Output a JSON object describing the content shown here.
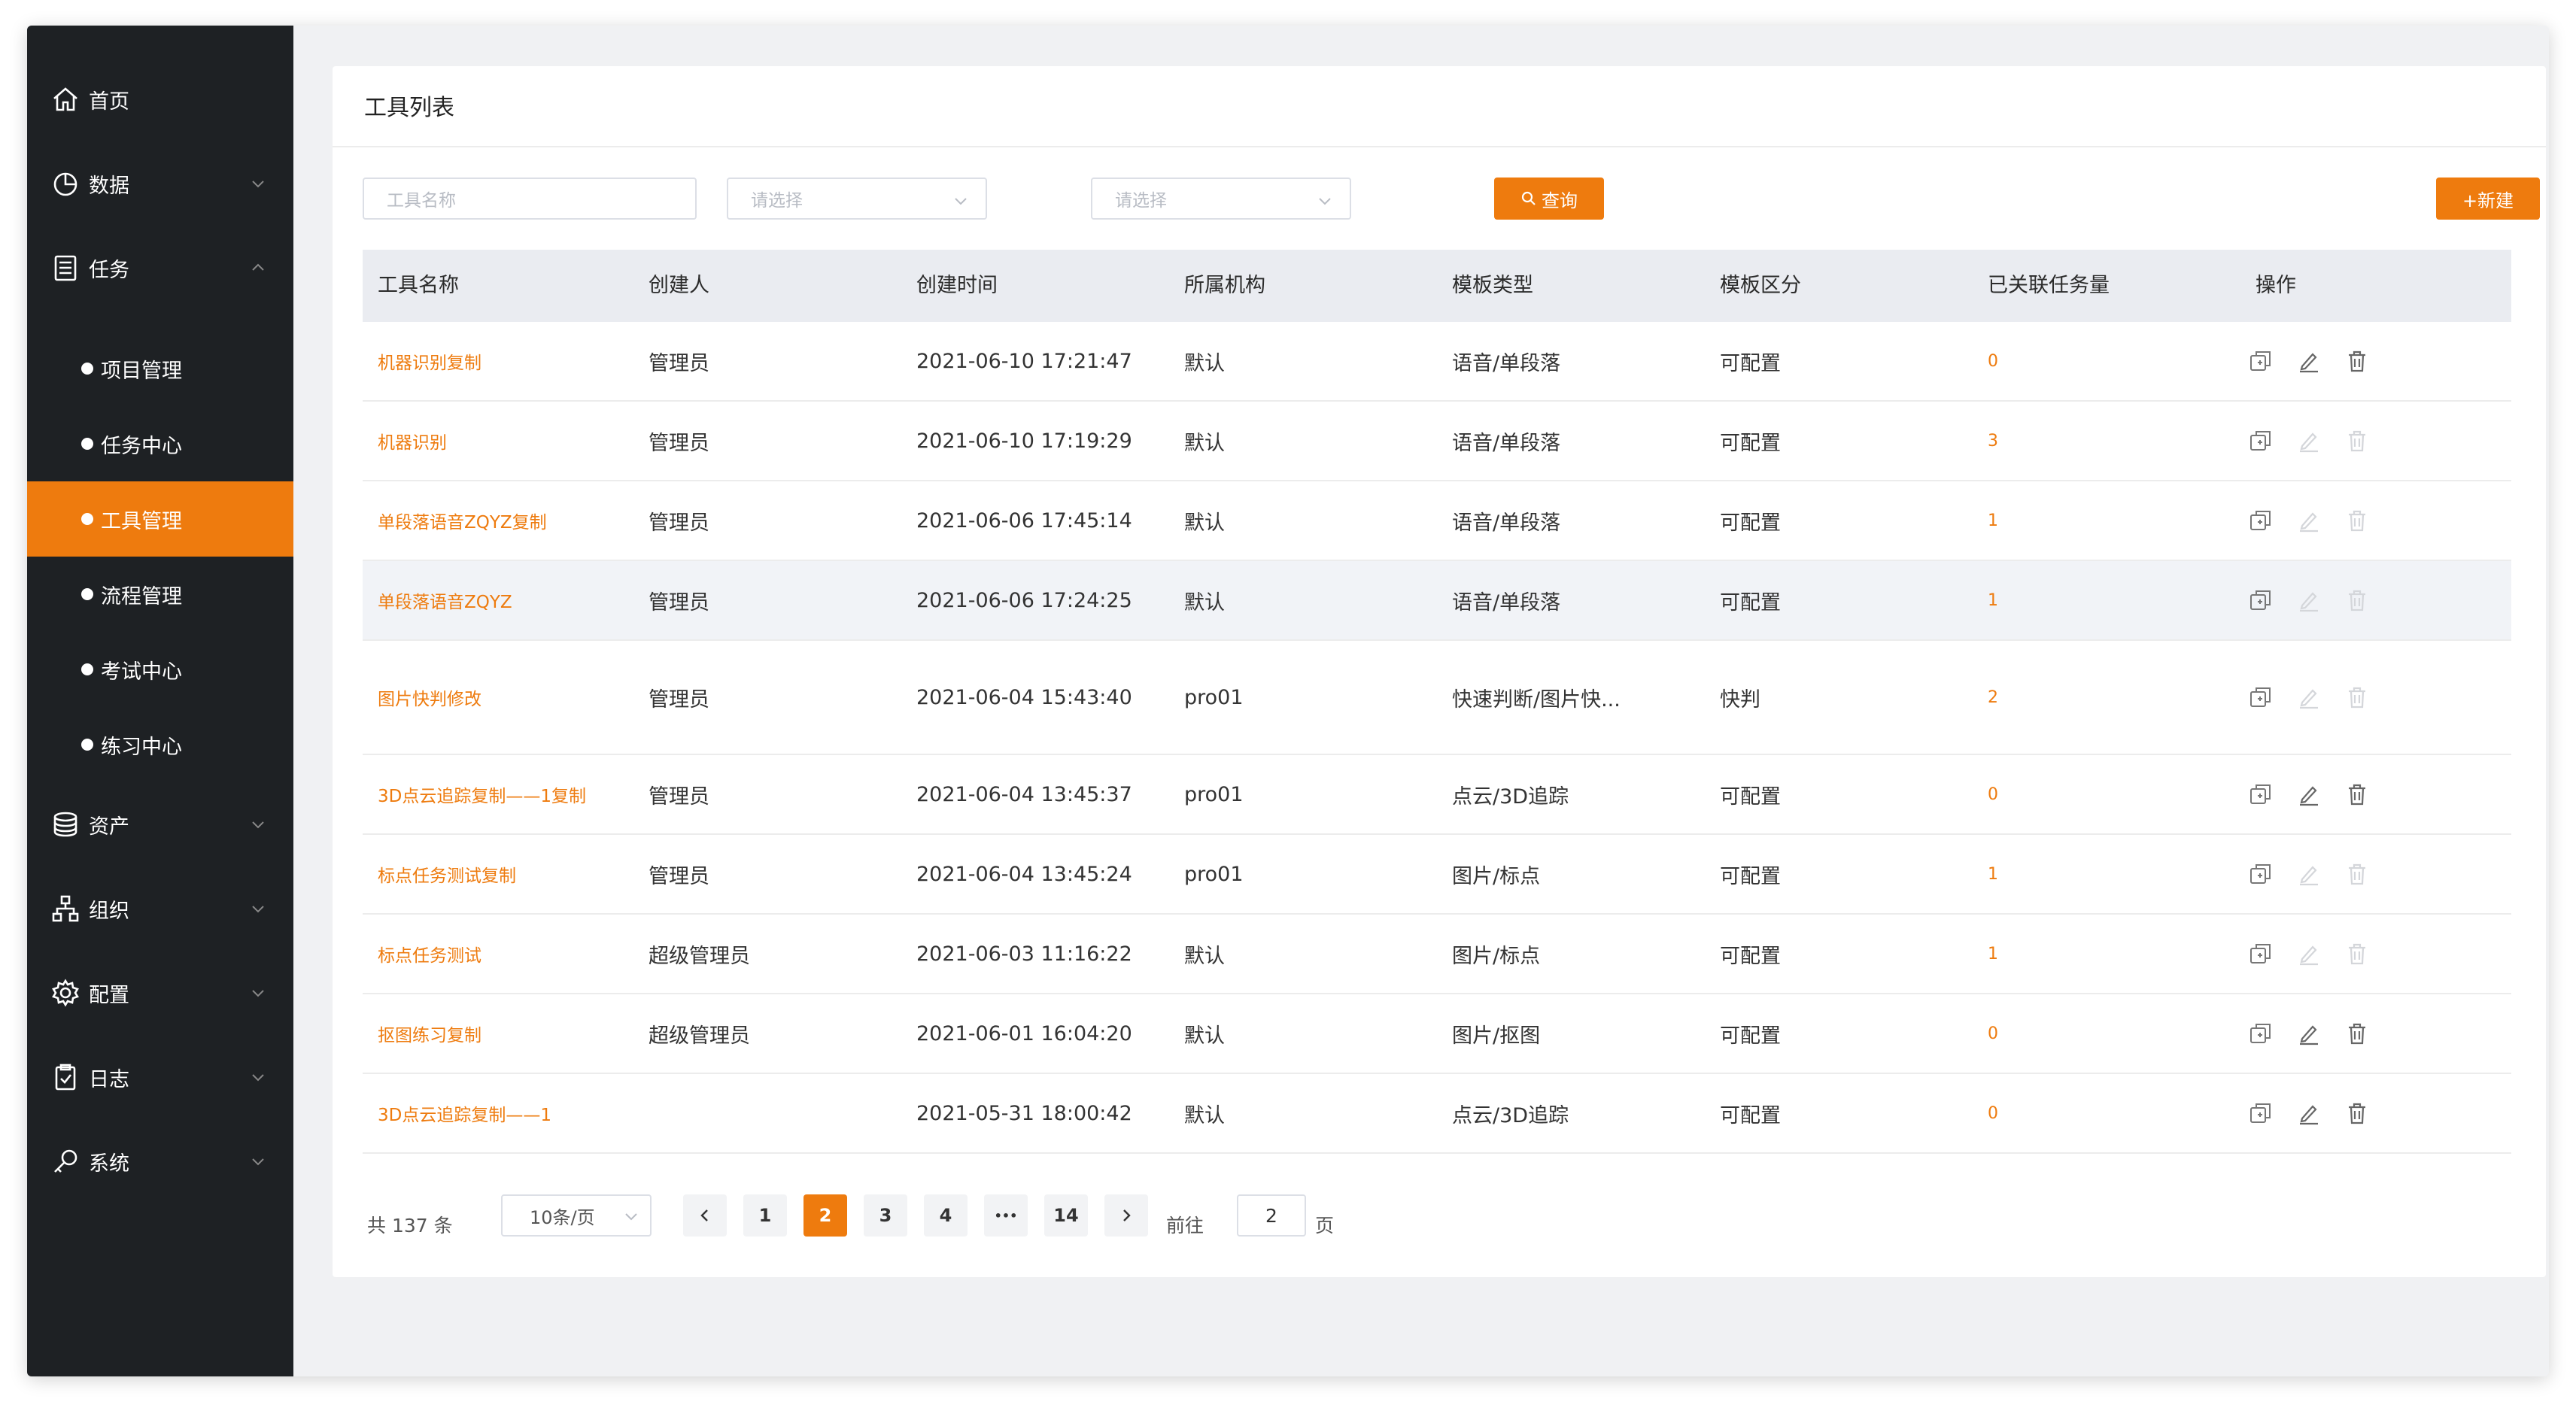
{
  "sidebar": {
    "items": [
      {
        "label": "首页",
        "icon": "home-icon"
      },
      {
        "label": "数据",
        "icon": "pie-chart-icon"
      },
      {
        "label": "任务",
        "icon": "task-list-icon"
      },
      {
        "label": "资产",
        "icon": "database-icon"
      },
      {
        "label": "组织",
        "icon": "org-chart-icon"
      },
      {
        "label": "配置",
        "icon": "gear-icon"
      },
      {
        "label": "日志",
        "icon": "clipboard-icon"
      },
      {
        "label": "系统",
        "icon": "key-icon"
      }
    ],
    "sub_items": [
      {
        "label": "项目管理"
      },
      {
        "label": "任务中心"
      },
      {
        "label": "工具管理",
        "active": true
      },
      {
        "label": "流程管理"
      },
      {
        "label": "考试中心"
      },
      {
        "label": "练习中心"
      }
    ]
  },
  "page": {
    "title": "工具列表"
  },
  "filters": {
    "name_placeholder": "工具名称",
    "select1_placeholder": "请选择",
    "select2_placeholder": "请选择",
    "query_label": "查询",
    "new_label": "+新建"
  },
  "table": {
    "columns": [
      "工具名称",
      "创建人",
      "创建时间",
      "所属机构",
      "模板类型",
      "模板区分",
      "已关联任务量",
      "操作"
    ],
    "rows": [
      {
        "name": "机器识别复制",
        "creator": "管理员",
        "created": "2021-06-10 17:21:47",
        "org": "默认",
        "type": "语音/单段落",
        "kind": "可配置",
        "count": "0",
        "editable": true
      },
      {
        "name": "机器识别",
        "creator": "管理员",
        "created": "2021-06-10 17:19:29",
        "org": "默认",
        "type": "语音/单段落",
        "kind": "可配置",
        "count": "3",
        "editable": false
      },
      {
        "name": "单段落语音ZQYZ复制",
        "creator": "管理员",
        "created": "2021-06-06 17:45:14",
        "org": "默认",
        "type": "语音/单段落",
        "kind": "可配置",
        "count": "1",
        "editable": false
      },
      {
        "name": "单段落语音ZQYZ",
        "creator": "管理员",
        "created": "2021-06-06 17:24:25",
        "org": "默认",
        "type": "语音/单段落",
        "kind": "可配置",
        "count": "1",
        "editable": false
      },
      {
        "name": "图片快判修改",
        "creator": "管理员",
        "created": "2021-06-04 15:43:40",
        "org": "pro01",
        "type": "快速判断/图片快...",
        "kind": "快判",
        "count": "2",
        "editable": false
      },
      {
        "name": "3D点云追踪复制——1复制",
        "creator": "管理员",
        "created": "2021-06-04 13:45:37",
        "org": "pro01",
        "type": "点云/3D追踪",
        "kind": "可配置",
        "count": "0",
        "editable": true
      },
      {
        "name": "标点任务测试复制",
        "creator": "管理员",
        "created": "2021-06-04 13:45:24",
        "org": "pro01",
        "type": "图片/标点",
        "kind": "可配置",
        "count": "1",
        "editable": false
      },
      {
        "name": "标点任务测试",
        "creator": "超级管理员",
        "created": "2021-06-03 11:16:22",
        "org": "默认",
        "type": "图片/标点",
        "kind": "可配置",
        "count": "1",
        "editable": false
      },
      {
        "name": "抠图练习复制",
        "creator": "超级管理员",
        "created": "2021-06-01 16:04:20",
        "org": "默认",
        "type": "图片/抠图",
        "kind": "可配置",
        "count": "0",
        "editable": true
      },
      {
        "name": "3D点云追踪复制——1",
        "creator": "",
        "created": "2021-05-31 18:00:42",
        "org": "默认",
        "type": "点云/3D追踪",
        "kind": "可配置",
        "count": "0",
        "editable": true
      }
    ]
  },
  "pagination": {
    "total_text": "共 137 条",
    "page_size": "10条/页",
    "pages": [
      "1",
      "2",
      "3",
      "4",
      "•••",
      "14"
    ],
    "current": "2",
    "goto_label": "前往",
    "goto_value": "2",
    "goto_unit": "页"
  },
  "colors": {
    "accent": "#ee7b0e",
    "sidebar_bg": "#1e2124"
  }
}
